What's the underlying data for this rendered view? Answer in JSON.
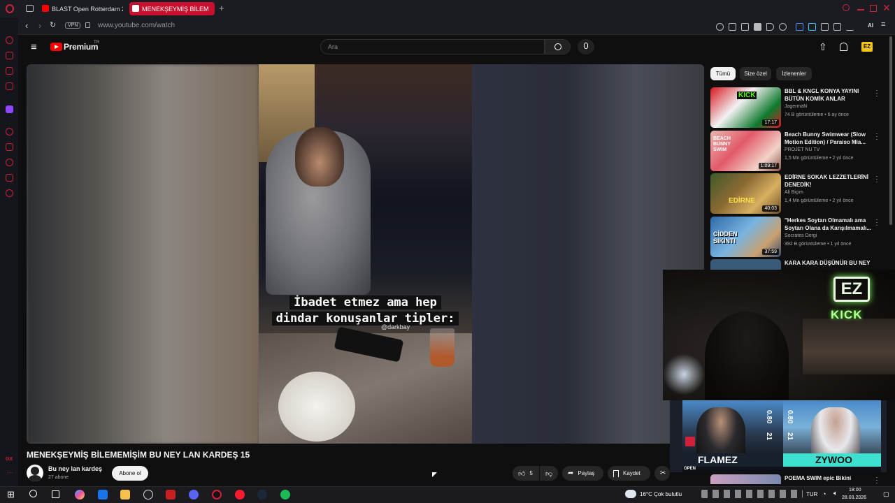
{
  "browser": {
    "tabs": [
      {
        "label": "BLAST Open Rotterdam 20"
      },
      {
        "label": "MENEKŞEYMİŞ BİLEM"
      }
    ],
    "vpn_label": "VPN",
    "url": "www.youtube.com/watch",
    "ai_label": "AI"
  },
  "youtube": {
    "logo_text": "Premium",
    "logo_sup": "TR",
    "search_placeholder": "Ara",
    "avatar_badge": "EZ"
  },
  "video": {
    "caption_line1": "İbadet etmez ama hep",
    "caption_line2": "dindar konuşanlar tipler:",
    "credit": "@darkbay",
    "title": "MENEKŞEYMİŞ BİLEMEMİŞİM BU NEY LAN KARDEŞ 15",
    "channel": "Bu ney lan kardeş",
    "subscribers": "27 abone",
    "subscribe_label": "Abone ol",
    "likes": "5",
    "share_label": "Paylaş",
    "save_label": "Kaydet"
  },
  "sidebar": {
    "chips": [
      "Tümü",
      "Size özel",
      "İzlenenler"
    ],
    "recommendations": [
      {
        "title": "BBL & KNGL KONYA YAYINI BÜTÜN KOMİK ANLAR",
        "channel": "JagermaN",
        "meta": "74 B görüntüleme • 6 ay önce",
        "duration": "17:17"
      },
      {
        "title": "Beach Bunny Swimwear (Slow Motion Edition) / Paraiso Mia...",
        "channel": "PROJET NU TV",
        "meta": "1,5 Mn görüntüleme • 2 yıl önce",
        "duration": "1:09:17"
      },
      {
        "title": "EDİRNE SOKAK LEZZETLERİNİ DENEDİK!",
        "channel": "Ali Biçim",
        "meta": "1,4 Mn görüntüleme • 2 yıl önce",
        "duration": "40:03"
      },
      {
        "title": "\"Herkes Soytarı Olmamalı ama Soytarı Olana da Karışılmamalı...",
        "channel": "Socrates Dergi",
        "meta": "392 B görüntüleme • 1 yıl önce",
        "duration": "37:59"
      },
      {
        "title": "KARA KARA DÜŞÜNÜR BU NEY",
        "channel": "",
        "meta": "",
        "duration": ""
      },
      {
        "title": "POEMA SWIM epic Bikini",
        "channel": "",
        "meta": "",
        "duration": ""
      }
    ],
    "thumb_texts": [
      "KICK",
      "BEACH BUNNY SWIM",
      "EDİRNE",
      "CİDDEN SIKINTI"
    ]
  },
  "stream": {
    "logo": "EZ",
    "kick_text": "KICK",
    "player_left": "FLAMEZ",
    "player_right": "ZYWOO",
    "stat": "0.80",
    "stat_num": "21",
    "open_label": "OPEN"
  },
  "taskbar": {
    "weather": "16°C  Çok bulutlu",
    "lang": "TUR",
    "time": "18:00",
    "date": "28.03.2026"
  },
  "colors": {
    "accent": "#d0213a",
    "yt_red": "#ff0000",
    "bg": "#0f0f0f"
  }
}
